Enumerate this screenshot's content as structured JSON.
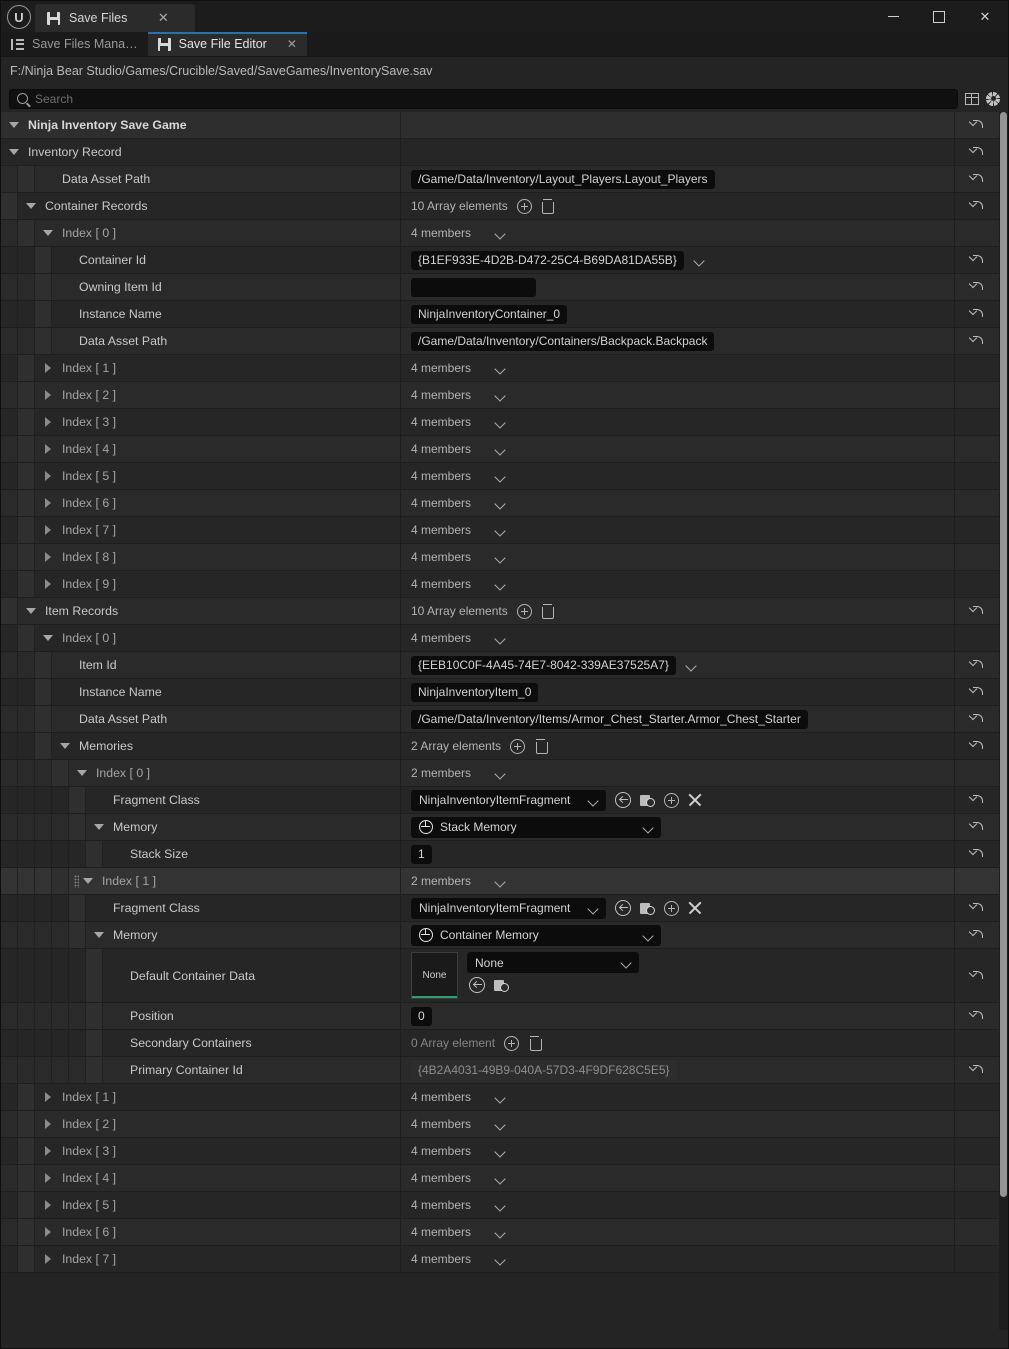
{
  "window": {
    "app_icon": "unreal-logo",
    "tab_title": "Save Files",
    "minimize": "—",
    "maximize": "☐",
    "close": "✕",
    "tab_close": "✕"
  },
  "doc_tabs": [
    {
      "label": "Save Files Mana…",
      "icon": "list-icon",
      "active": false,
      "closable": false
    },
    {
      "label": "Save File Editor",
      "icon": "floppy-icon",
      "active": true,
      "closable": true,
      "close": "✕"
    }
  ],
  "path": "F:/Ninja Bear Studio/Games/Crucible/Saved/SaveGames/InventorySave.sav",
  "search": {
    "placeholder": "Search",
    "value": ""
  },
  "toolbar": {
    "grid_icon": "grid-view-icon",
    "settings_icon": "gear-icon"
  },
  "colors": {
    "accent_tab": "#2a6fae",
    "thumbnail_underline": "#2f9e6e",
    "row_bg": "#2a2a2a",
    "row_bg_alt": "#262626",
    "row_hover": "#333333"
  },
  "labels": {
    "array_add": "add-element-icon",
    "array_clear": "delete-icon",
    "reset": "reset-to-default-icon",
    "expand": "expand-arrow",
    "collapse": "collapse-arrow"
  },
  "rows": [
    {
      "id": "r0",
      "indent": 0,
      "label": "Ninja Inventory Save Game",
      "style": "bold",
      "toggle": "down",
      "kind": "header",
      "value": null
    },
    {
      "id": "r1",
      "indent": 0,
      "label": "Inventory Record",
      "toggle": "down",
      "kind": "none",
      "value": null
    },
    {
      "id": "r2",
      "indent": 2,
      "label": "Data Asset Path",
      "toggle": "none",
      "kind": "text",
      "value": "/Game/Data/Inventory/Layout_Players.Layout_Players"
    },
    {
      "id": "r3",
      "indent": 1,
      "label": "Container Records",
      "toggle": "down",
      "kind": "array",
      "value": "10 Array elements"
    },
    {
      "id": "r4",
      "indent": 2,
      "label": "Index [ 0 ]",
      "toggle": "down",
      "kind": "members",
      "dim": true,
      "value": "4 members"
    },
    {
      "id": "r5",
      "indent": 3,
      "label": "Container Id",
      "toggle": "none",
      "kind": "text-chev",
      "value": "{B1EF933E-4D2B-D472-25C4-B69DA81DA55B}"
    },
    {
      "id": "r6",
      "indent": 3,
      "label": "Owning Item Id",
      "toggle": "none",
      "kind": "text-empty",
      "value": ""
    },
    {
      "id": "r7",
      "indent": 3,
      "label": "Instance Name",
      "toggle": "none",
      "kind": "text",
      "value": "NinjaInventoryContainer_0"
    },
    {
      "id": "r8",
      "indent": 3,
      "label": "Data Asset Path",
      "toggle": "none",
      "kind": "text",
      "value": "/Game/Data/Inventory/Containers/Backpack.Backpack"
    },
    {
      "id": "r9",
      "indent": 2,
      "label": "Index [ 1 ]",
      "toggle": "right",
      "kind": "members",
      "dim": true,
      "value": "4 members"
    },
    {
      "id": "r10",
      "indent": 2,
      "label": "Index [ 2 ]",
      "toggle": "right",
      "kind": "members",
      "dim": true,
      "value": "4 members"
    },
    {
      "id": "r11",
      "indent": 2,
      "label": "Index [ 3 ]",
      "toggle": "right",
      "kind": "members",
      "dim": true,
      "value": "4 members"
    },
    {
      "id": "r12",
      "indent": 2,
      "label": "Index [ 4 ]",
      "toggle": "right",
      "kind": "members",
      "dim": true,
      "value": "4 members"
    },
    {
      "id": "r13",
      "indent": 2,
      "label": "Index [ 5 ]",
      "toggle": "right",
      "kind": "members",
      "dim": true,
      "value": "4 members"
    },
    {
      "id": "r14",
      "indent": 2,
      "label": "Index [ 6 ]",
      "toggle": "right",
      "kind": "members",
      "dim": true,
      "value": "4 members"
    },
    {
      "id": "r15",
      "indent": 2,
      "label": "Index [ 7 ]",
      "toggle": "right",
      "kind": "members",
      "dim": true,
      "value": "4 members"
    },
    {
      "id": "r16",
      "indent": 2,
      "label": "Index [ 8 ]",
      "toggle": "right",
      "kind": "members",
      "dim": true,
      "value": "4 members"
    },
    {
      "id": "r17",
      "indent": 2,
      "label": "Index [ 9 ]",
      "toggle": "right",
      "kind": "members",
      "dim": true,
      "value": "4 members"
    },
    {
      "id": "r18",
      "indent": 1,
      "label": "Item Records",
      "toggle": "down",
      "kind": "array",
      "value": "10 Array elements"
    },
    {
      "id": "r19",
      "indent": 2,
      "label": "Index [ 0 ]",
      "toggle": "down",
      "kind": "members",
      "dim": true,
      "value": "4 members"
    },
    {
      "id": "r20",
      "indent": 3,
      "label": "Item Id",
      "toggle": "none",
      "kind": "text-chev",
      "value": "{EEB10C0F-4A45-74E7-8042-339AE37525A7}"
    },
    {
      "id": "r21",
      "indent": 3,
      "label": "Instance Name",
      "toggle": "none",
      "kind": "text",
      "value": "NinjaInventoryItem_0"
    },
    {
      "id": "r22",
      "indent": 3,
      "label": "Data Asset Path",
      "toggle": "none",
      "kind": "text",
      "value": "/Game/Data/Inventory/Items/Armor_Chest_Starter.Armor_Chest_Starter"
    },
    {
      "id": "r23",
      "indent": 3,
      "label": "Memories",
      "toggle": "down",
      "kind": "array",
      "value": "2 Array elements"
    },
    {
      "id": "r24",
      "indent": 4,
      "label": "Index [ 0 ]",
      "toggle": "down",
      "kind": "members",
      "dim": true,
      "value": "2 members"
    },
    {
      "id": "r25",
      "indent": 5,
      "label": "Fragment Class",
      "toggle": "none",
      "kind": "class-picker",
      "value": "NinjaInventoryItemFragment"
    },
    {
      "id": "r26",
      "indent": 5,
      "label": "Memory",
      "toggle": "down",
      "kind": "struct-combo",
      "value": "Stack Memory"
    },
    {
      "id": "r27",
      "indent": 6,
      "label": "Stack Size",
      "toggle": "none",
      "kind": "text",
      "value": "1"
    },
    {
      "id": "r28",
      "indent": 4,
      "label": "Index [ 1 ]",
      "toggle": "down",
      "kind": "members",
      "dim": true,
      "hover": true,
      "grip": true,
      "value": "2 members"
    },
    {
      "id": "r29",
      "indent": 5,
      "label": "Fragment Class",
      "toggle": "none",
      "kind": "class-picker",
      "value": "NinjaInventoryItemFragment"
    },
    {
      "id": "r30",
      "indent": 5,
      "label": "Memory",
      "toggle": "down",
      "kind": "struct-combo",
      "value": "Container Memory"
    },
    {
      "id": "r31",
      "indent": 6,
      "label": "Default Container Data",
      "toggle": "none",
      "kind": "asset-picker",
      "value": "None",
      "thumbnail": "None"
    },
    {
      "id": "r32",
      "indent": 6,
      "label": "Position",
      "toggle": "none",
      "kind": "text",
      "value": "0"
    },
    {
      "id": "r33",
      "indent": 6,
      "label": "Secondary Containers",
      "toggle": "none",
      "kind": "array-empty",
      "value": "0 Array element"
    },
    {
      "id": "r34",
      "indent": 6,
      "label": "Primary Container Id",
      "toggle": "none",
      "kind": "text-ro",
      "value": "{4B2A4031-49B9-040A-57D3-4F9DF628C5E5}"
    },
    {
      "id": "r35",
      "indent": 2,
      "label": "Index [ 1 ]",
      "toggle": "right",
      "kind": "members",
      "dim": true,
      "value": "4 members"
    },
    {
      "id": "r36",
      "indent": 2,
      "label": "Index [ 2 ]",
      "toggle": "right",
      "kind": "members",
      "dim": true,
      "value": "4 members"
    },
    {
      "id": "r37",
      "indent": 2,
      "label": "Index [ 3 ]",
      "toggle": "right",
      "kind": "members",
      "dim": true,
      "value": "4 members"
    },
    {
      "id": "r38",
      "indent": 2,
      "label": "Index [ 4 ]",
      "toggle": "right",
      "kind": "members",
      "dim": true,
      "value": "4 members"
    },
    {
      "id": "r39",
      "indent": 2,
      "label": "Index [ 5 ]",
      "toggle": "right",
      "kind": "members",
      "dim": true,
      "value": "4 members"
    },
    {
      "id": "r40",
      "indent": 2,
      "label": "Index [ 6 ]",
      "toggle": "right",
      "kind": "members",
      "dim": true,
      "value": "4 members"
    },
    {
      "id": "r41",
      "indent": 2,
      "label": "Index [ 7 ]",
      "toggle": "right",
      "kind": "members",
      "dim": true,
      "value": "4 members"
    }
  ]
}
